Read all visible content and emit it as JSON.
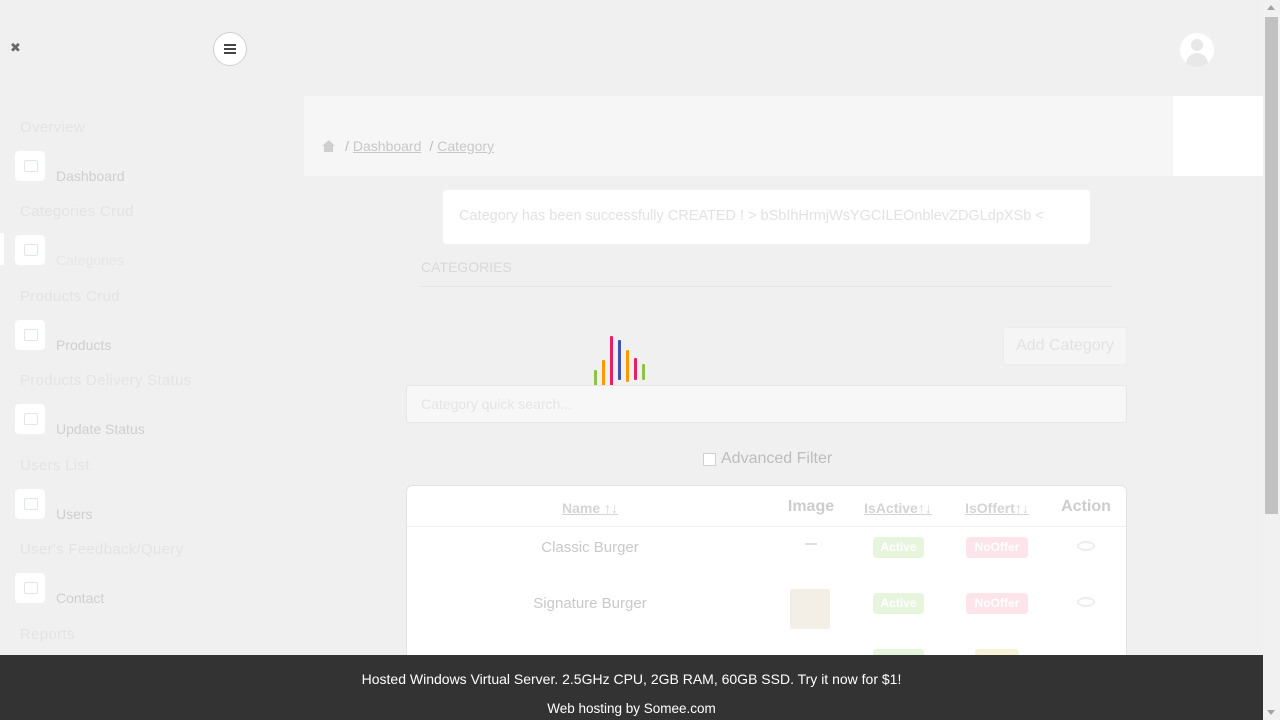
{
  "sidebar": {
    "sections": [
      {
        "title": "Overview",
        "item": "Dashboard",
        "icon": "home-icon"
      },
      {
        "title": "Categories Crud",
        "item": "Categories",
        "icon": "category-icon",
        "active": true
      },
      {
        "title": "Products Crud",
        "item": "Products",
        "icon": "product-icon"
      },
      {
        "title": "Products Delivery Status",
        "item": "Update Status",
        "icon": "status-icon"
      },
      {
        "title": "Users List",
        "item": "Users",
        "icon": "users-icon"
      },
      {
        "title": "User's Feedback/Query",
        "item": "Contact",
        "icon": "contact-icon"
      },
      {
        "title": "Reports"
      }
    ]
  },
  "breadcrumb": {
    "sep": "/",
    "items": [
      "Dashboard",
      "Category"
    ]
  },
  "alert": {
    "message": "Category has been successfully CREATED ! > bSbIhHrmjWsYGCILEOnblevZDGLdpXSb <"
  },
  "main": {
    "heading": "CATEGORIES",
    "add_button": "Add Category",
    "search_placeholder": "Category quick search...",
    "advanced_filter": "Advanced Filter"
  },
  "table": {
    "headers": {
      "name": "Name ↑↓",
      "image": "Image",
      "is_active": "IsActive↑↓",
      "is_offer": "IsOffert↑↓",
      "action": "Action"
    },
    "rows": [
      {
        "name": "Classic Burger",
        "active": "Active",
        "offer": "NoOffer"
      },
      {
        "name": "Signature Burger",
        "active": "Active",
        "offer": "NoOffer"
      }
    ]
  },
  "footer": {
    "line1": "Hosted Windows Virtual Server. 2.5GHz CPU, 2GB RAM, 60GB SSD. Try it now for $1!",
    "line2": "Web hosting by Somee.com"
  },
  "loader_colors": [
    "#8bc34a",
    "#ff9800",
    "#e91e63",
    "#3f51b5",
    "#ff9800",
    "#e91e63",
    "#8bc34a"
  ]
}
